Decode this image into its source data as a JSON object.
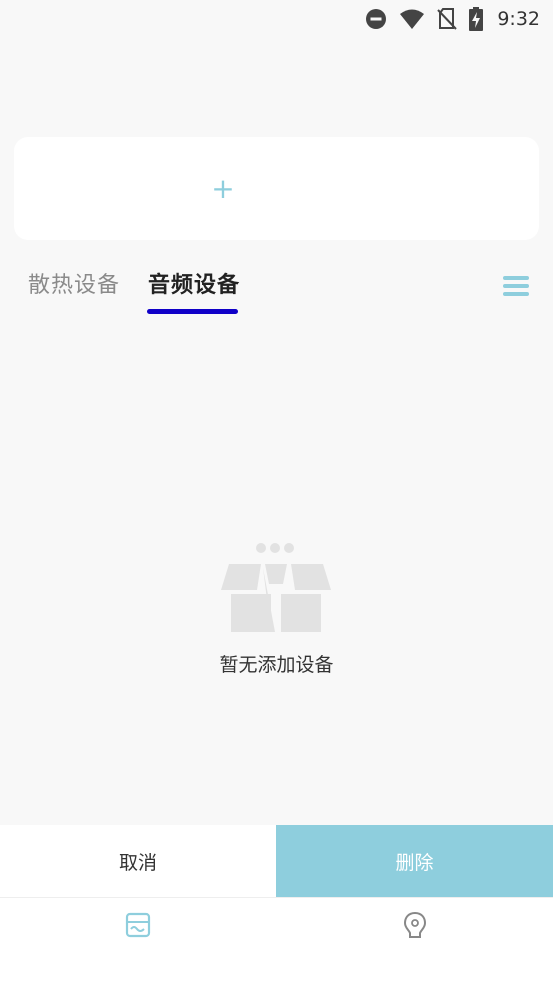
{
  "status_bar": {
    "time": "9:32",
    "icons": [
      "do-not-disturb-icon",
      "wifi-icon",
      "no-sim-icon",
      "battery-charging-icon"
    ]
  },
  "add_card": {
    "add_symbol": "+"
  },
  "tabs": [
    {
      "label": "散热设备",
      "active": false
    },
    {
      "label": "音频设备",
      "active": true
    }
  ],
  "empty_state": {
    "icon": "empty-box-icon",
    "message": "暂无添加设备"
  },
  "action_bar": {
    "cancel_label": "取消",
    "delete_label": "删除"
  },
  "bottom_nav": {
    "items": [
      {
        "icon": "devices-icon",
        "active": true
      },
      {
        "icon": "profile-icon",
        "active": false
      }
    ]
  },
  "colors": {
    "accent": "#8ecedd",
    "tab_indicator": "#1000c8",
    "background": "#f8f8f8"
  }
}
